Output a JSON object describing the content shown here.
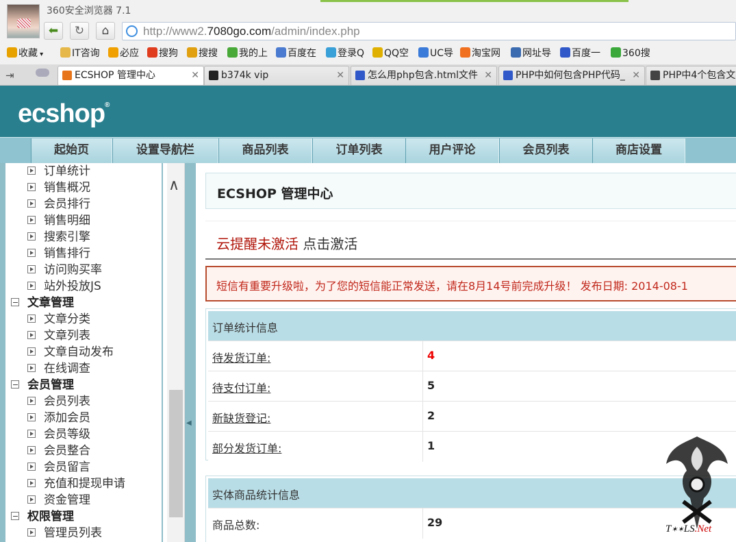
{
  "browser": {
    "title": "360安全浏览器 7.1",
    "url_prefix": "http://www2.",
    "url_domain": "7080go.com",
    "url_path": "/admin/index.php"
  },
  "bookmarks": [
    {
      "label": "收藏",
      "icon": "star-icon",
      "color": "#e8a200"
    },
    {
      "label": "IT咨询",
      "icon": "folder-icon",
      "color": "#e6b84a"
    },
    {
      "label": "必应",
      "icon": "bing-icon",
      "color": "#f0a000"
    },
    {
      "label": "搜狗",
      "icon": "sogou-icon",
      "color": "#e03c1e"
    },
    {
      "label": "搜搜",
      "icon": "soso-icon",
      "color": "#e0a010"
    },
    {
      "label": "我的上",
      "icon": "plus-icon",
      "color": "#48a838"
    },
    {
      "label": "百度在",
      "icon": "doc-icon",
      "color": "#4a7bd0"
    },
    {
      "label": "登录Q",
      "icon": "globe-icon",
      "color": "#3aa0d8"
    },
    {
      "label": "QQ空",
      "icon": "star-icon",
      "color": "#e0b000"
    },
    {
      "label": "UC导",
      "icon": "uc-icon",
      "color": "#3a7ad8"
    },
    {
      "label": "淘宝网",
      "icon": "taobao-icon",
      "color": "#f07020"
    },
    {
      "label": "网址导",
      "icon": "s-icon",
      "color": "#3a6ab0"
    },
    {
      "label": "百度一",
      "icon": "baidu-icon",
      "color": "#3058c8"
    },
    {
      "label": "360搜",
      "icon": "search-icon",
      "color": "#3aa83a"
    }
  ],
  "tabs": [
    {
      "label": "ECSHOP 管理中心",
      "icon": "cart-icon",
      "color": "#e8741a",
      "active": true
    },
    {
      "label": "b374k vip",
      "icon": "skull-icon",
      "color": "#222222",
      "active": false
    },
    {
      "label": "怎么用php包含.html文件",
      "icon": "baidu-icon",
      "color": "#3058c8",
      "active": false
    },
    {
      "label": "PHP中如何包含PHP代码_",
      "icon": "baidu-icon",
      "color": "#3058c8",
      "active": false
    },
    {
      "label": "PHP中4个包含文",
      "icon": "m-icon",
      "color": "#444444",
      "active": false
    }
  ],
  "header": {
    "logo": "ecshop",
    "menu": [
      "起始页",
      "设置导航栏",
      "商品列表",
      "订单列表",
      "用户评论",
      "会员列表",
      "商店设置"
    ]
  },
  "tree": [
    {
      "label": "订单统计",
      "group": false
    },
    {
      "label": "销售概况",
      "group": false
    },
    {
      "label": "会员排行",
      "group": false
    },
    {
      "label": "销售明细",
      "group": false
    },
    {
      "label": "搜索引擎",
      "group": false
    },
    {
      "label": "销售排行",
      "group": false
    },
    {
      "label": "访问购买率",
      "group": false
    },
    {
      "label": "站外投放JS",
      "group": false
    },
    {
      "label": "文章管理",
      "group": true
    },
    {
      "label": "文章分类",
      "group": false
    },
    {
      "label": "文章列表",
      "group": false
    },
    {
      "label": "文章自动发布",
      "group": false
    },
    {
      "label": "在线调查",
      "group": false
    },
    {
      "label": "会员管理",
      "group": true
    },
    {
      "label": "会员列表",
      "group": false
    },
    {
      "label": "添加会员",
      "group": false
    },
    {
      "label": "会员等级",
      "group": false
    },
    {
      "label": "会员整合",
      "group": false
    },
    {
      "label": "会员留言",
      "group": false
    },
    {
      "label": "充值和提现申请",
      "group": false
    },
    {
      "label": "资金管理",
      "group": false
    },
    {
      "label": "权限管理",
      "group": true
    },
    {
      "label": "管理员列表",
      "group": false
    }
  ],
  "main": {
    "title": "ECSHOP 管理中心",
    "cloud_alert": "云提醒未激活",
    "cloud_activate": "点击激活",
    "notice": "短信有重要升级啦，为了您的短信能正常发送，请在8月14号前完成升级！  发布日期: 2014-08-1",
    "order_stats": {
      "heading": "订单统计信息",
      "rows": [
        {
          "label": "待发货订单:",
          "value": "4",
          "highlight": true
        },
        {
          "label": "待支付订单:",
          "value": "5",
          "highlight": false
        },
        {
          "label": "新缺货登记:",
          "value": "2",
          "highlight": false
        },
        {
          "label": "部分发货订单:",
          "value": "1",
          "highlight": false
        }
      ]
    },
    "goods_stats": {
      "heading": "实体商品统计信息",
      "rows": [
        {
          "label": "商品总数:",
          "value": "29"
        }
      ]
    }
  },
  "watermark": {
    "text": "T",
    "net": ".Net"
  }
}
